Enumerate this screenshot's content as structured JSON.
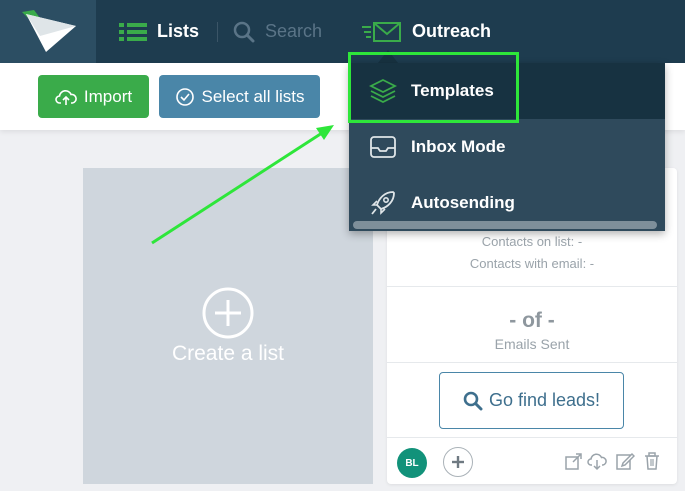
{
  "nav": {
    "lists_label": "Lists",
    "search_label": "Search",
    "outreach_label": "Outreach"
  },
  "toolbar": {
    "import_label": "Import",
    "select_all_label": "Select all lists"
  },
  "create_card": {
    "label": "Create a list"
  },
  "list_card": {
    "contacts_on_list": "Contacts on list: -",
    "contacts_with_email": "Contacts with email: -",
    "of_value": "- of -",
    "emails_sent": "Emails Sent",
    "find_leads_label": "Go find leads!",
    "avatar_initials": "BL"
  },
  "dropdown": {
    "items": [
      {
        "label": "Templates",
        "icon": "layers-icon"
      },
      {
        "label": "Inbox Mode",
        "icon": "inbox-icon"
      },
      {
        "label": "Autosending",
        "icon": "rocket-icon"
      }
    ]
  },
  "colors": {
    "topbar": "#1e3c4f",
    "accent_green": "#3aab4a",
    "accent_blue": "#4a86a8",
    "highlight": "#2ee63a",
    "avatar": "#12927a"
  }
}
